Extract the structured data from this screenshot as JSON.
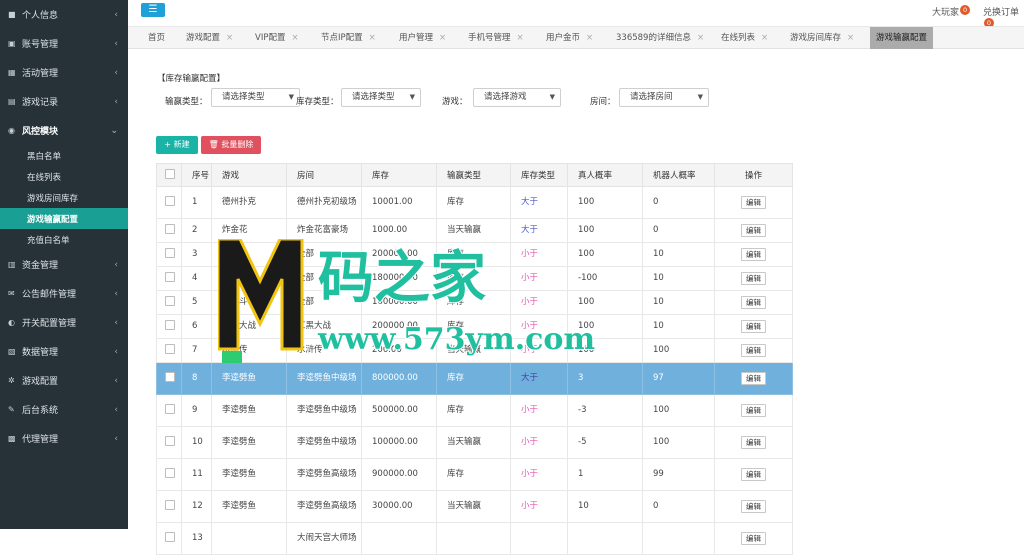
{
  "sidebar": {
    "items": [
      {
        "label": "个人信息",
        "icon": "user-icon"
      },
      {
        "label": "账号管理",
        "icon": "id-card-icon"
      },
      {
        "label": "活动管理",
        "icon": "calendar-icon"
      },
      {
        "label": "游戏记录",
        "icon": "record-icon"
      },
      {
        "label": "风控模块",
        "icon": "eye-icon",
        "open": true,
        "children": [
          "黑白名单",
          "在线列表",
          "游戏房间库存",
          "游戏输赢配置",
          "充值白名单"
        ],
        "active_child": "游戏输赢配置"
      },
      {
        "label": "资金管理",
        "icon": "money-icon"
      },
      {
        "label": "公告邮件管理",
        "icon": "mail-icon"
      },
      {
        "label": "开关配置管理",
        "icon": "toggle-icon"
      },
      {
        "label": "数据管理",
        "icon": "chart-icon"
      },
      {
        "label": "游戏配置",
        "icon": "gear-icon"
      },
      {
        "label": "后台系统",
        "icon": "wrench-icon"
      },
      {
        "label": "代理管理",
        "icon": "sitemap-icon"
      }
    ]
  },
  "topbar": {
    "menu_icon": "☰",
    "user_link": "大玩家",
    "user_badge": "0",
    "orders_link": "兑换订单",
    "orders_badge": "0"
  },
  "tabs": [
    {
      "label": "首页",
      "closable": false
    },
    {
      "label": "游戏配置",
      "closable": true
    },
    {
      "label": "VIP配置",
      "closable": true
    },
    {
      "label": "节点IP配置",
      "closable": true
    },
    {
      "label": "用户管理",
      "closable": true
    },
    {
      "label": "手机号管理",
      "closable": true
    },
    {
      "label": "用户金币",
      "closable": true
    },
    {
      "label": "336589的详细信息",
      "closable": true
    },
    {
      "label": "在线列表",
      "closable": true
    },
    {
      "label": "游戏房间库存",
      "closable": true
    },
    {
      "label": "游戏输赢配置",
      "closable": false,
      "active": true
    }
  ],
  "panel": {
    "title": "【库存输赢配置】",
    "filters": {
      "win_type_label": "输赢类型：",
      "win_type_value": "请选择类型",
      "stock_type_label": "库存类型：",
      "stock_type_value": "请选择类型",
      "game_label": "游戏：",
      "game_value": "请选择游戏",
      "room_label": "房间：",
      "room_value": "请选择房间"
    },
    "buttons": {
      "new": "新建",
      "batch_delete": "批量删除"
    }
  },
  "table": {
    "headers": [
      "序号",
      "游戏",
      "房间",
      "库存",
      "输赢类型",
      "库存类型",
      "真人概率",
      "机器人概率",
      "操作"
    ],
    "edit_label": "编辑",
    "rows": [
      {
        "no": "1",
        "game": "德州扑克",
        "room": "德州扑克初级场",
        "stock": "10001.00",
        "wtype": "库存",
        "stype": "大于",
        "human": "100",
        "robot": "0",
        "tall": true
      },
      {
        "no": "2",
        "game": "炸金花",
        "room": "炸金花富豪场",
        "stock": "1000.00",
        "wtype": "当天输赢",
        "stype": "大于",
        "human": "100",
        "robot": "0"
      },
      {
        "no": "3",
        "game": "龙虎斗",
        "room": "全部",
        "stock": "200000.00",
        "wtype": "库存",
        "stype": "小于",
        "human": "100",
        "robot": "10"
      },
      {
        "no": "4",
        "game": "龙虎斗",
        "room": "全部",
        "stock": "180000.00",
        "wtype": "库存",
        "stype": "小于",
        "human": "-100",
        "robot": "10"
      },
      {
        "no": "5",
        "game": "龙虎斗",
        "room": "全部",
        "stock": "160000.00",
        "wtype": "库存",
        "stype": "小于",
        "human": "100",
        "robot": "10"
      },
      {
        "no": "6",
        "game": "红黑大战",
        "room": "红黑大战",
        "stock": "200000.00",
        "wtype": "库存",
        "stype": "小于",
        "human": "100",
        "robot": "10"
      },
      {
        "no": "7",
        "game": "水浒传",
        "room": "水浒传",
        "stock": "200.00",
        "wtype": "当天输赢",
        "stype": "小于",
        "human": "100",
        "robot": "100"
      },
      {
        "no": "8",
        "game": "李逵劈鱼",
        "room": "李逵劈鱼中级场",
        "stock": "800000.00",
        "wtype": "库存",
        "stype": "大于",
        "human": "3",
        "robot": "97",
        "tall": true,
        "selected": true
      },
      {
        "no": "9",
        "game": "李逵劈鱼",
        "room": "李逵劈鱼中级场",
        "stock": "500000.00",
        "wtype": "库存",
        "stype": "小于",
        "human": "-3",
        "robot": "100",
        "tall": true
      },
      {
        "no": "10",
        "game": "李逵劈鱼",
        "room": "李逵劈鱼中级场",
        "stock": "100000.00",
        "wtype": "当天输赢",
        "stype": "小于",
        "human": "-5",
        "robot": "100",
        "tall": true
      },
      {
        "no": "11",
        "game": "李逵劈鱼",
        "room": "李逵劈鱼高级场",
        "stock": "900000.00",
        "wtype": "库存",
        "stype": "小于",
        "human": "1",
        "robot": "99",
        "tall": true
      },
      {
        "no": "12",
        "game": "李逵劈鱼",
        "room": "李逵劈鱼高级场",
        "stock": "30000.00",
        "wtype": "当天输赢",
        "stype": "小于",
        "human": "10",
        "robot": "0",
        "tall": true
      },
      {
        "no": "13",
        "game": "",
        "room": "大闹天宫大师场",
        "stock": "",
        "wtype": "",
        "stype": "",
        "human": "",
        "robot": "",
        "tall": true
      }
    ]
  },
  "watermark": {
    "title": "码之家",
    "url": "www.573ym.com",
    "logo_letter": "M"
  },
  "colors": {
    "sidebar_bg": "#263238",
    "active_menu": "#1a9f95",
    "greater": "#4a57c8",
    "less": "#e356b1",
    "selected_row": "#6fb0dd",
    "new_button": "#1ab3a6",
    "delete_button": "#e0505e"
  }
}
